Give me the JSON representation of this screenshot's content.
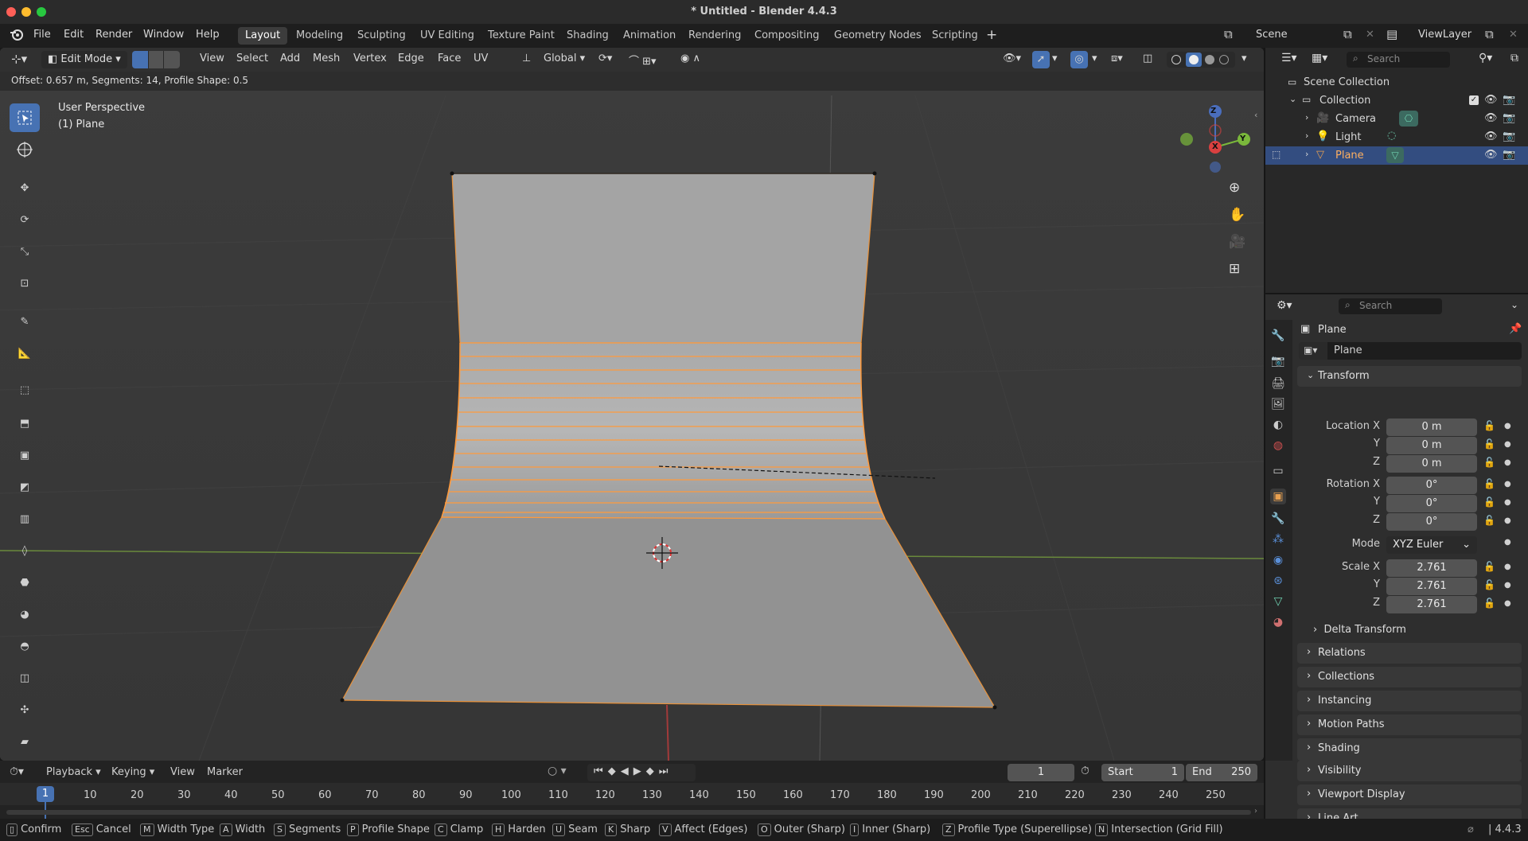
{
  "window": {
    "title": "* Untitled - Blender 4.4.3"
  },
  "menu": {
    "items": [
      "File",
      "Edit",
      "Render",
      "Window",
      "Help"
    ]
  },
  "workspaces": [
    "Layout",
    "Modeling",
    "Sculpting",
    "UV Editing",
    "Texture Paint",
    "Shading",
    "Animation",
    "Rendering",
    "Compositing",
    "Geometry Nodes",
    "Scripting"
  ],
  "active_workspace": "Layout",
  "scene": {
    "name": "Scene",
    "view_layer": "ViewLayer"
  },
  "viewport_header": {
    "mode": "Edit Mode",
    "menus": [
      "View",
      "Select",
      "Add",
      "Mesh",
      "Vertex",
      "Edge",
      "Face",
      "UV"
    ],
    "orientation": "Global"
  },
  "operator": {
    "text": "Offset: 0.657 m, Segments: 14, Profile Shape: 0.5"
  },
  "overlay": {
    "perspective": "User Perspective",
    "object": "(1) Plane"
  },
  "gizmo": {
    "z": "Z",
    "y": "Y",
    "x": "X"
  },
  "outliner": {
    "search": "Search",
    "root": "Scene Collection",
    "collection": "Collection",
    "items": [
      "Camera",
      "Light",
      "Plane"
    ]
  },
  "properties": {
    "search": "Search",
    "object": "Plane",
    "data_name": "Plane",
    "transform": "Transform",
    "location_label": "Location X",
    "rotation_label": "Rotation X",
    "scale_label": "Scale X",
    "y": "Y",
    "z": "Z",
    "loc": [
      "0 m",
      "0 m",
      "0 m"
    ],
    "rot": [
      "0°",
      "0°",
      "0°"
    ],
    "mode_label": "Mode",
    "mode": "XYZ Euler",
    "scale": [
      "2.761",
      "2.761",
      "2.761"
    ],
    "sections": [
      "Delta Transform",
      "Relations",
      "Collections",
      "Instancing",
      "Motion Paths",
      "Shading",
      "Visibility",
      "Viewport Display",
      "Line Art"
    ]
  },
  "timeline": {
    "menus": [
      "Playback",
      "Keying",
      "View",
      "Marker"
    ],
    "current": "1",
    "start_label": "Start",
    "start": "1",
    "end_label": "End",
    "end": "250",
    "ticks": [
      "10",
      "20",
      "30",
      "40",
      "50",
      "60",
      "70",
      "80",
      "90",
      "100",
      "110",
      "120",
      "130",
      "140",
      "150",
      "160",
      "170",
      "180",
      "190",
      "200",
      "210",
      "220",
      "230",
      "240",
      "250"
    ]
  },
  "status": {
    "items": [
      {
        "key": "",
        "label": "Confirm"
      },
      {
        "key": "Esc",
        "label": "Cancel"
      },
      {
        "key": "M",
        "label": "Width Type"
      },
      {
        "key": "A",
        "label": "Width"
      },
      {
        "key": "S",
        "label": "Segments"
      },
      {
        "key": "P",
        "label": "Profile Shape"
      },
      {
        "key": "C",
        "label": "Clamp"
      },
      {
        "key": "H",
        "label": "Harden"
      },
      {
        "key": "U",
        "label": "Seam"
      },
      {
        "key": "K",
        "label": "Sharp"
      },
      {
        "key": "V",
        "label": "Affect (Edges)"
      },
      {
        "key": "O",
        "label": "Outer (Sharp)"
      },
      {
        "key": "I",
        "label": "Inner (Sharp)"
      },
      {
        "key": "Z",
        "label": "Profile Type (Superellipse)"
      },
      {
        "key": "N",
        "label": "Intersection (Grid Fill)"
      }
    ],
    "version": "4.4.3"
  },
  "colors": {
    "accent": "#4772b3",
    "selected_edge": "#ff9a3c",
    "active_orange": "#e87d0d"
  }
}
